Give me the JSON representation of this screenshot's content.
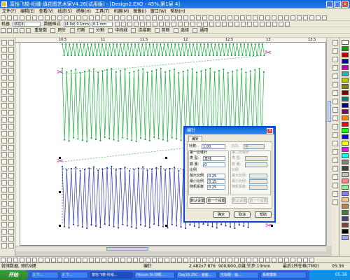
{
  "window": {
    "title": "富怡飞梭-绗缝·填花图艺术家V4.26[试用版] - [Design2.EXO - 45%,第1层 4]",
    "controls": [
      "_",
      "□",
      "×"
    ]
  },
  "menu": [
    "文件(F)",
    "编辑(E)",
    "查看(V)",
    "线迹(S)",
    "绣框(H)",
    "工具(T)",
    "机器(M)",
    "图像(I)",
    "窗口(W)",
    "帮助(H)"
  ],
  "toolbar2": {
    "machine_label": "机器",
    "machine_value": "绣花机",
    "data_format_label": "数据格式",
    "data_format_value": "(4.0d) 0.1mm",
    "unit_label": "0.1 mm"
  },
  "toolbar3": {
    "items": [
      "重复数",
      "跨针",
      "打断",
      "分割",
      "中间线",
      "连接图",
      "剪断",
      "选择",
      "通用"
    ]
  },
  "ruler_marks": [
    "10.5",
    "11",
    "11.5",
    "12",
    "12.5",
    "13",
    "13.5"
  ],
  "dialog": {
    "title": "编针",
    "tab": "编针",
    "count_label": "针数:",
    "count_value": "1.00",
    "right_top_label": "方向:",
    "right_top_value": "等",
    "section1": "第一比缝针",
    "type_label": "类 型:",
    "type_value": "直线",
    "count2_label": "数 量:",
    "count2_value": "0",
    "ratio_label": "比例",
    "max_ratio_label": "最大比例",
    "max_ratio_value": "0.25",
    "min_ratio_label": "最小比例",
    "min_ratio_value": "0.15",
    "random_label": "随机系数",
    "random_value": "0.25",
    "section2": "第二比缝针",
    "right_labels": [
      "类 型:",
      "数 量:",
      "比例",
      "最大比例",
      "最小比例",
      "随机系数"
    ],
    "restore1": "默认设置",
    "restore2": "前一个设置",
    "ok": "确定",
    "cancel": "取消",
    "help": "帮助"
  },
  "status": {
    "left": "就绪数据, 预约9键",
    "mid1": "编针",
    "coords": "2.482x7.876",
    "stitches": "900/900,点缝,针步:10mm",
    "info": "最后1所在格(TMD)",
    "right": "05:36"
  },
  "taskbar": {
    "start": "开始",
    "tasks": [
      "2 个...",
      "2 个...",
      "富怡飞梭-绗缝...",
      "Hilcom SI-印绣...",
      "Day16.25C - 画面...",
      "无标题 - 画...",
      "系统模板"
    ],
    "clock": "05:36"
  },
  "palette_colors": [
    "#ffffff",
    "#00a000",
    "#c00000",
    "#0000c0",
    "#c000c0",
    "#00c0c0",
    "#c0c000",
    "#808000",
    "#800000",
    "#008080",
    "#000080",
    "#800080",
    "#ff8000",
    "#ff0000",
    "#00ff00",
    "#0000ff",
    "#ffff00",
    "#ff00ff",
    "#00ffff",
    "#808080",
    "#404040",
    "#c0c0c0",
    "#ff8080",
    "#80ff80",
    "#8080ff",
    "#ffc080",
    "#c08040",
    "#408040",
    "#404080",
    "#804040",
    "#000000",
    "#a0a0ff"
  ]
}
